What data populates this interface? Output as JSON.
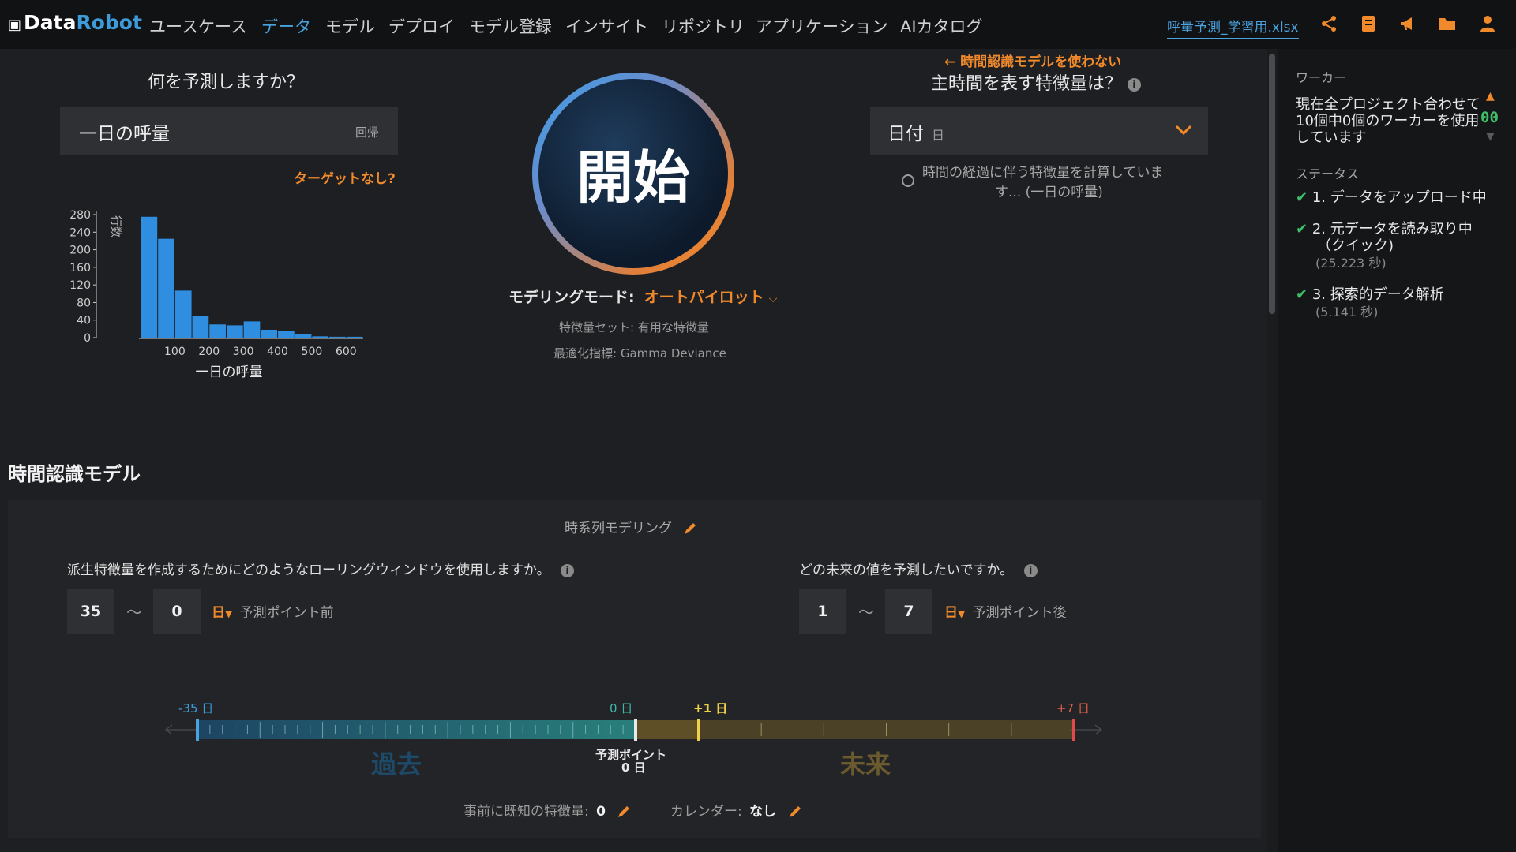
{
  "nav": {
    "logo_data": "Data",
    "logo_robot": "Robot",
    "items": [
      "ユースケース",
      "データ",
      "モデル",
      "デプロイ",
      "モデル登録",
      "インサイト",
      "リポジトリ",
      "アプリケーション",
      "AIカタログ"
    ],
    "file_name": "呼量予測_学習用.xlsx"
  },
  "target": {
    "question": "何を予測しますか？",
    "value": "一日の呼量",
    "type": "回帰",
    "no_target_link": "ターゲットなし?"
  },
  "start": {
    "label": "開始",
    "mode_label": "モデリングモード:",
    "mode_value": "オートパイロット",
    "feature_set": "特徴量セット: 有用な特徴量",
    "metric": "最適化指標: Gamma Deviance"
  },
  "time": {
    "no_time_link": "時間認識モデルを使わない",
    "question": "主時間を表す特徴量は？",
    "value": "日付",
    "unit": "日",
    "calc_line1": "時間の経過に伴う特徴量を計算していま",
    "calc_line2": "す... (一日の呼量)"
  },
  "ts": {
    "section_title": "時間認識モデル",
    "modeling_label": "時系列モデリング",
    "rolling_q": "派生特徴量を作成するためにどのようなローリングウィンドウを使用しますか。",
    "forecast_q": "どの未来の値を予測したいですか。",
    "fdw_start": "35",
    "fdw_end": "0",
    "fw_start": "1",
    "fw_end": "7",
    "tilde": "～",
    "unit": "日",
    "before_label": "予測ポイント前",
    "after_label": "予測ポイント後",
    "tl_minus35": "-35 日",
    "tl_zero": "0 日",
    "tl_plus1": "+1 日",
    "tl_plus7": "+7 日",
    "past": "過去",
    "future": "未来",
    "fp_label": "予測ポイント",
    "fp_sub": "0 日",
    "known_label": "事前に既知の特徴量:",
    "known_value": "0",
    "calendar_label": "カレンダー:",
    "calendar_value": "なし"
  },
  "worker": {
    "header": "ワーカー",
    "line1": "現在全プロジェクト合わせて",
    "line2": "10個中0個のワーカーを使用",
    "line3": "しています",
    "count": "00"
  },
  "status": {
    "header": "ステータス",
    "steps": [
      {
        "label": "1. データをアップロード中",
        "time": ""
      },
      {
        "label": "2. 元データを読み取り中",
        "label2": "（クイック)",
        "time": "(25.223 秒)"
      },
      {
        "label": "3. 探索的データ解析",
        "time": "(5.141 秒)"
      }
    ]
  },
  "colors": {
    "accent_blue": "#4aa3df",
    "accent_orange": "#f08a2b",
    "bar_blue": "#2f8ee0",
    "check_green": "#3fbf6a"
  },
  "chart_data": {
    "type": "bar",
    "xlabel": "一日の呼量",
    "ylabel": "行数",
    "y_ticks": [
      "280",
      "240",
      "200",
      "160",
      "120",
      "80",
      "40",
      "0"
    ],
    "x_ticks": [
      "100",
      "200",
      "300",
      "400",
      "500",
      "600"
    ],
    "ylim": [
      0,
      280
    ],
    "bins": [
      {
        "x0": 0,
        "x1": 50,
        "value": 275
      },
      {
        "x0": 50,
        "x1": 100,
        "value": 225
      },
      {
        "x0": 100,
        "x1": 150,
        "value": 107
      },
      {
        "x0": 150,
        "x1": 200,
        "value": 50
      },
      {
        "x0": 200,
        "x1": 250,
        "value": 30
      },
      {
        "x0": 250,
        "x1": 300,
        "value": 28
      },
      {
        "x0": 300,
        "x1": 350,
        "value": 37
      },
      {
        "x0": 350,
        "x1": 400,
        "value": 18
      },
      {
        "x0": 400,
        "x1": 450,
        "value": 16
      },
      {
        "x0": 450,
        "x1": 500,
        "value": 8
      },
      {
        "x0": 500,
        "x1": 550,
        "value": 3
      },
      {
        "x0": 550,
        "x1": 600,
        "value": 2
      },
      {
        "x0": 600,
        "x1": 650,
        "value": 2
      }
    ]
  }
}
